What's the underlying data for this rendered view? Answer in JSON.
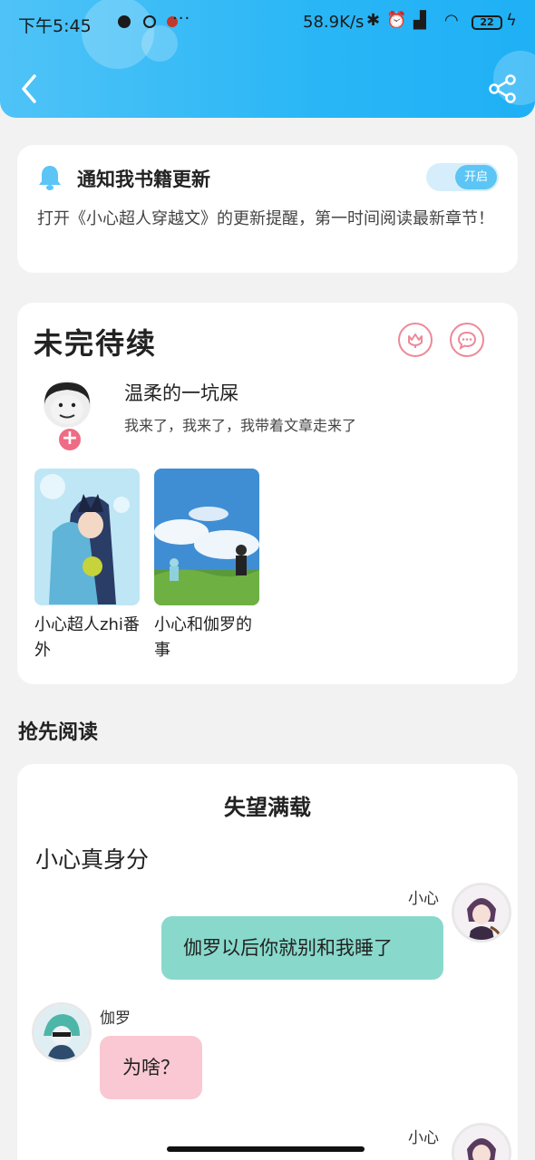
{
  "statusbar": {
    "time": "下午5:45",
    "more": "···",
    "net_speed": "58.9K/s",
    "battery": "22"
  },
  "notify": {
    "title": "通知我书籍更新",
    "toggle_label": "开启",
    "description": "打开《小心超人穿越文》的更新提醒，第一时间阅读最新章节！"
  },
  "author": {
    "section_title": "未完待续",
    "name": "温柔的一坑屎",
    "motto": "我来了，我来了，我带着文章走来了",
    "follow_symbol": "+",
    "books": [
      {
        "title": "小心超人zhi番外"
      },
      {
        "title": "小心和伽罗的事"
      }
    ]
  },
  "preview": {
    "heading": "抢先阅读",
    "book_title": "失望满载",
    "chapter_title": "小心真身分",
    "messages": [
      {
        "sender": "小心",
        "text": "伽罗以后你就别和我睡了"
      },
      {
        "sender": "伽罗",
        "text": "为啥？"
      },
      {
        "sender": "小心",
        "text": ""
      }
    ]
  },
  "colors": {
    "header_start": "#4fc3f7",
    "header_end": "#1fb0f5",
    "right_bubble": "#88d9cb",
    "left_bubble": "#f9c8d2",
    "accent_pink": "#ee6c84"
  }
}
